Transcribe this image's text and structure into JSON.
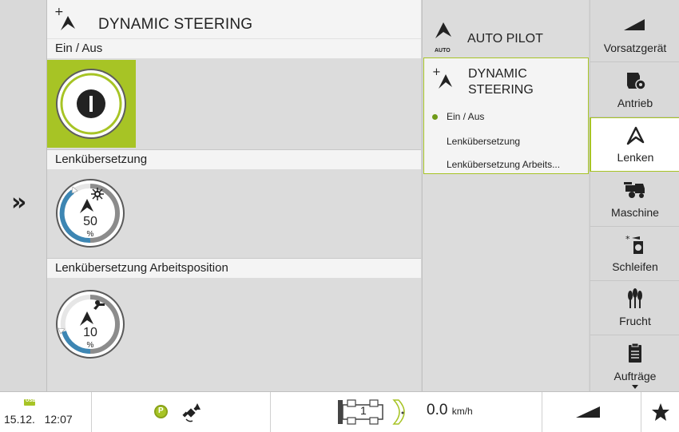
{
  "main": {
    "title": "DYNAMIC STEERING",
    "sections": [
      {
        "label": "Ein / Aus",
        "state": "on"
      },
      {
        "label": "Lenkübersetzung",
        "value": "50",
        "unit": "%",
        "level_percent": 50
      },
      {
        "label": "Lenkübersetzung Arbeitsposition",
        "value": "10",
        "unit": "%",
        "level_percent": 10
      }
    ]
  },
  "left_strip": {
    "expand_glyph": "»"
  },
  "middle": {
    "autopilot": {
      "label": "AUTO PILOT",
      "badge": "AUTO"
    },
    "dynamic_steering": {
      "title_line1": "DYNAMIC",
      "title_line2": "STEERING",
      "items": [
        "Ein / Aus",
        "Lenkübersetzung",
        "Lenkübersetzung Arbeits..."
      ],
      "active_index": 0
    }
  },
  "nav": {
    "items": [
      {
        "label": "Vorsatzgerät",
        "icon": "header-icon"
      },
      {
        "label": "Antrieb",
        "icon": "drive-icon"
      },
      {
        "label": "Lenken",
        "icon": "steering-icon",
        "active": true
      },
      {
        "label": "Maschine",
        "icon": "harvester-icon"
      },
      {
        "label": "Schleifen",
        "icon": "grinding-icon"
      },
      {
        "label": "Frucht",
        "icon": "crop-icon"
      },
      {
        "label": "Aufträge",
        "icon": "orders-icon"
      }
    ]
  },
  "status": {
    "usb": "USB",
    "date": "15.12.",
    "time": "12:07",
    "parking": "P",
    "gear": "1",
    "speed": "0.0",
    "speed_unit": "km/h"
  },
  "colors": {
    "accent": "#a7c425",
    "gauge_blue": "#3d86b3",
    "dark": "#222222"
  }
}
